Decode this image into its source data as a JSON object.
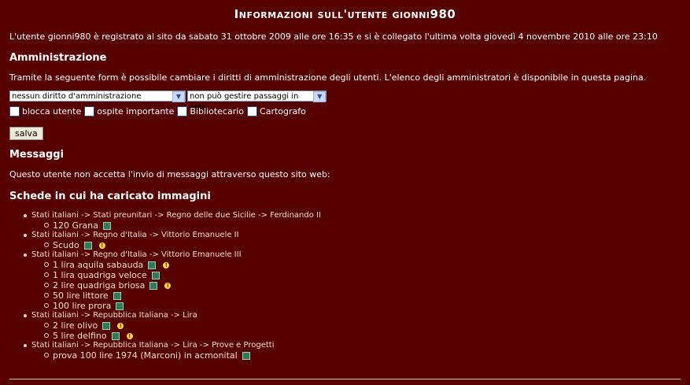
{
  "page": {
    "title": "Informazioni sull'utente gionni980",
    "info": "L'utente gionni980 è registrato al sito da sabato 31 ottobre 2009 alle ore 16:35 e si è collegato l'ultima volta giovedì 4 novembre 2010 alle ore 23:10"
  },
  "admin": {
    "heading": "Amministrazione",
    "description": "Tramite la seguente form è possibile cambiare i diritti di amministrazione degli utenti. L'elenco degli amministratori è disponibile in questa pagina.",
    "select_rights": "nessun diritto d'amministrazione",
    "select_passaggi": "non può gestire passaggi in asta",
    "checkboxes": [
      "blocca utente",
      "ospite importante",
      "Bibliotecario",
      "Cartografo"
    ],
    "save_label": "salva"
  },
  "messages": {
    "heading": "Messaggi",
    "text": "Questo utente non accetta l'invio di messaggi attraverso questo sito web:"
  },
  "schede": {
    "heading": "Schede in cui ha caricato immagini",
    "categories": [
      {
        "path": "Stati italiani -> Stati preunitari -> Regno delle due Sicilie -> Ferdinando II",
        "items": [
          {
            "name": "120 Grana",
            "warning": false
          }
        ]
      },
      {
        "path": "Stati italiani -> Regno d'Italia -> Vittorio Emanuele II",
        "items": [
          {
            "name": "Scudo",
            "warning": true
          }
        ]
      },
      {
        "path": "Stati italiani -> Regno d'Italia -> Vittorio Emanuele III",
        "items": [
          {
            "name": "1 lira aquila sabauda",
            "warning": true
          },
          {
            "name": "1 lira quadriga veloce",
            "warning": false
          },
          {
            "name": "2 lire quadriga briosa",
            "warning": true
          },
          {
            "name": "50 lire littore",
            "warning": false
          },
          {
            "name": "100 lire prora",
            "warning": false
          }
        ]
      },
      {
        "path": "Stati italiani -> Repubblica Italiana -> Lira",
        "items": [
          {
            "name": "2 lire olivo",
            "warning": true
          },
          {
            "name": "5 lire delfino",
            "warning": true
          }
        ]
      },
      {
        "path": "Stati italiani -> Repubblica Italiana -> Lira -> Prove e Progetti",
        "items": [
          {
            "name": "prova 100 lire 1974 (Marconi) in acmonital",
            "warning": false
          }
        ]
      }
    ]
  },
  "icons": {
    "picture": "picture-icon",
    "warning": "warning-icon"
  }
}
